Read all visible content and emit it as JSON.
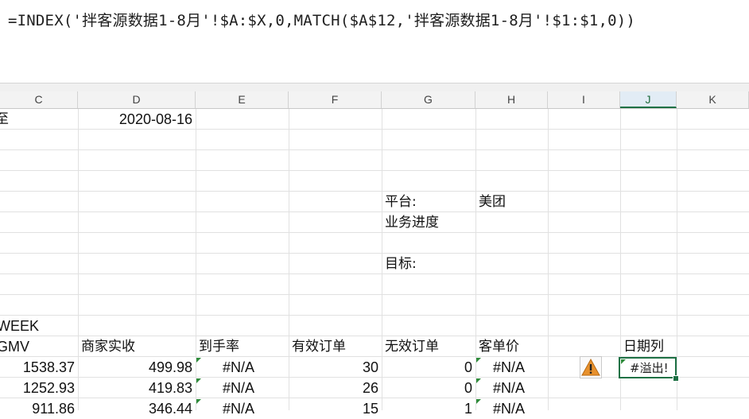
{
  "formula_bar": {
    "formula": "=INDEX('拌客源数据1-8月'!$A:$X,0,MATCH($A$12,'拌客源数据1-8月'!$1:$1,0))"
  },
  "columns": [
    "C",
    "D",
    "E",
    "F",
    "G",
    "H",
    "I",
    "J",
    "K"
  ],
  "active_column": "J",
  "rows": {
    "date_row": {
      "label_partial": "至",
      "date": "2020-08-16"
    },
    "platform": {
      "label": "平台:",
      "value": "美团"
    },
    "progress": {
      "label": "业务进度"
    },
    "target": {
      "label": "目标:"
    },
    "week": {
      "label": "WEEK"
    }
  },
  "table": {
    "headers": [
      "GMV",
      "商家实收",
      "到手率",
      "有效订单",
      "无效订单",
      "客单价"
    ],
    "date_col_header": "日期列",
    "rows": [
      [
        "1538.37",
        "499.98",
        "#N/A",
        "30",
        "0",
        "#N/A"
      ],
      [
        "1252.93",
        "419.83",
        "#N/A",
        "26",
        "0",
        "#N/A"
      ],
      [
        "911.86",
        "346.44",
        "#N/A",
        "15",
        "1",
        "#N/A"
      ]
    ]
  },
  "selected_cell": {
    "value": "#溢出!"
  },
  "colors": {
    "accent_green": "#1e7145",
    "error_triangle": "#2e8b3a",
    "warning_orange": "#e8912d"
  }
}
